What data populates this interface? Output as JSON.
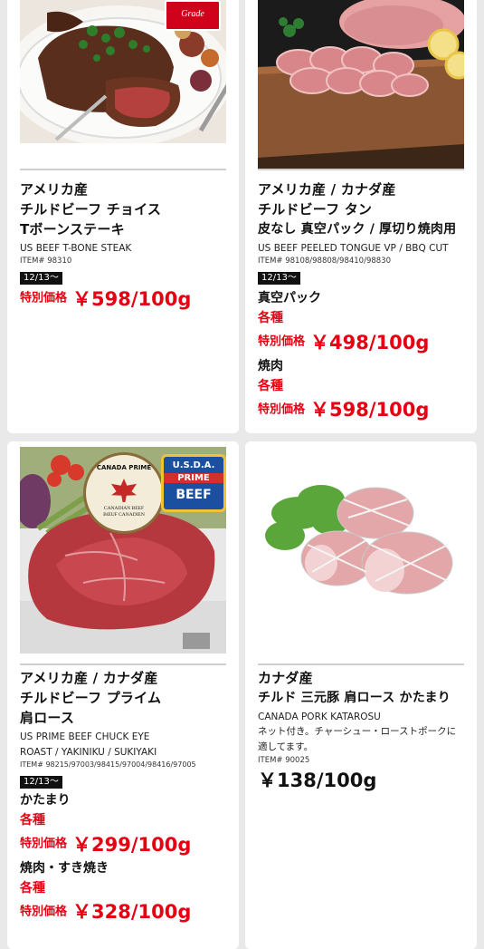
{
  "products": [
    {
      "title_lines": [
        "アメリカ産",
        "チルドビーフ チョイス",
        "Tボーンステーキ"
      ],
      "english": "US BEEF T-BONE STEAK",
      "item": "ITEM# 98310",
      "date_badge": "12/13〜",
      "special_label": "特別価格",
      "price": "￥598/100g",
      "photo_badge": "Grade"
    },
    {
      "title_lines": [
        "アメリカ産 / カナダ産",
        "チルドビーフ タン",
        "皮なし 真空パック / 厚切り焼肉用"
      ],
      "english": "US BEEF PEELED TONGUE VP / BBQ CUT",
      "item": "ITEM# 98108/98808/98410/98830",
      "date_badge": "12/13〜",
      "variants": [
        {
          "name": "真空パック",
          "sub": "各種",
          "special_label": "特別価格",
          "price": "￥498/100g"
        },
        {
          "name": "焼肉",
          "sub": "各種",
          "special_label": "特別価格",
          "price": "￥598/100g"
        }
      ]
    },
    {
      "title_lines": [
        "アメリカ産 / カナダ産",
        "チルドビーフ プライム",
        "肩ロース"
      ],
      "english_lines": [
        "US PRIME BEEF CHUCK EYE",
        "ROAST / YAKINIKU / SUKIYAKI"
      ],
      "item": "ITEM# 98215/97003/98415/97004/98416/97005",
      "date_badge": "12/13〜",
      "photo_badges": {
        "canada_top": "CANADA PRIME",
        "canada_bottom_1": "CANADIAN BEEF",
        "canada_bottom_2": "BŒUF CANADIEN",
        "usda": "U.S.D.A.",
        "prime": "PRIME",
        "beef": "BEEF"
      },
      "variants": [
        {
          "name": "かたまり",
          "sub": "各種",
          "special_label": "特別価格",
          "price": "￥299/100g"
        },
        {
          "name": "焼肉・すき焼き",
          "sub": "各種",
          "special_label": "特別価格",
          "price": "￥328/100g"
        }
      ]
    },
    {
      "title_lines": [
        "カナダ産",
        "チルド 三元豚 肩ロース かたまり"
      ],
      "english": "CANADA PORK KATAROSU",
      "note": "ネット付き。チャーシュー・ローストポークに適してます。",
      "item": "ITEM# 90025",
      "price": "￥138/100g"
    }
  ]
}
